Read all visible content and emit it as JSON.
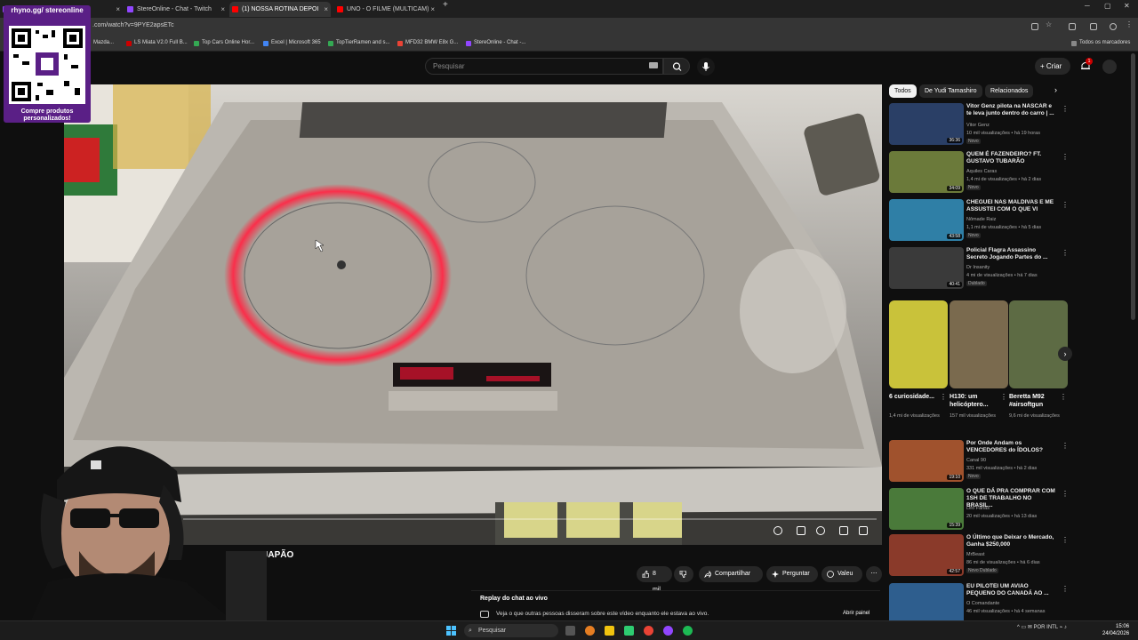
{
  "browser": {
    "tabs": [
      {
        "label": "",
        "color": "#9146ff"
      },
      {
        "label": "StereOnline - Chat - Twitch",
        "color": "#9146ff"
      },
      {
        "label": "(1) NOSSA ROTINA DEPOI",
        "color": "#ff0000"
      },
      {
        "label": "UNO - O FILME (MULTICAM)",
        "color": "#ff0000"
      }
    ],
    "new_tab": "+",
    "url": ".com/watch?v=9PYE2apsETc",
    "bookmarks": [
      {
        "label": "Mazda...",
        "color": "#555555"
      },
      {
        "label": "LS Miata V2.0 Full B...",
        "color": "#cc0000"
      },
      {
        "label": "Top Cars Online Hor...",
        "color": "#34a853"
      },
      {
        "label": "Excel | Microsoft 365",
        "color": "#4285f4"
      },
      {
        "label": "TopTierRamen and s...",
        "color": "#34a853"
      },
      {
        "label": "MFD32 BMW E8x G...",
        "color": "#ea4335"
      },
      {
        "label": "StereOnline - Chat -...",
        "color": "#9146ff"
      }
    ],
    "all_bookmarks": "Todos os marcadores"
  },
  "overlay": {
    "qr_top": "rhyno.gg/ stereonline",
    "qr_bottom": "Compre produtos personalizados!"
  },
  "youtube": {
    "search_placeholder": "Pesquisar",
    "create_label": "Criar",
    "notification_count": "1",
    "video_title": "NO JAPÃO",
    "video_title_prefix": "N",
    "actions": {
      "like": "8 mil",
      "share": "Compartilhar",
      "ask": "Perguntar",
      "thanks": "Valeu"
    },
    "chat_replay": {
      "title": "Replay do chat ao vivo",
      "description": "Veja o que outras pessoas disseram sobre este vídeo enquanto ele estava ao vivo.",
      "open": "Abrir painel"
    },
    "chips": [
      "Todos",
      "De Yudi Tamashiro",
      "Relacionados"
    ],
    "recs": [
      {
        "title": "Vitor Genz pilota na NASCAR e te leva junto dentro do carro | ...",
        "channel": "Vitor Genz",
        "meta": "10 mil visualizações • há 19 horas",
        "badge": "Novo",
        "duration": "36:36",
        "color": "#2a3f66"
      },
      {
        "title": "QUEM É FAZENDEIRO? FT. GUSTAVO TUBARÃO",
        "channel": "Aquiles Caras",
        "meta": "1,4 mi de visualizações • há 2 dias",
        "badge": "Novo",
        "duration": "34:09",
        "color": "#6b7a3a"
      },
      {
        "title": "CHEGUEI NAS MALDIVAS E ME ASSUSTEI COM O QUE VI",
        "channel": "Nômade Raiz",
        "meta": "1,1 mi de visualizações • há 5 dias",
        "badge": "Novo",
        "duration": "43:58",
        "color": "#2f7fa6"
      },
      {
        "title": "Policial Flagra Assassino Secreto Jogando Partes do ...",
        "channel": "Dr Insanity",
        "meta": "4 mi de visualizações • há 7 dias",
        "badge": "Dublado",
        "duration": "40:41",
        "color": "#3a3a3a"
      }
    ],
    "shorts": [
      {
        "title": "6 curiosidade...",
        "views": "1,4 mi de visualizações",
        "color": "#c9c23a"
      },
      {
        "title": "H130: um helicóptero...",
        "views": "157 mil visualizações",
        "color": "#7a6a4e"
      },
      {
        "title": "Beretta M92 #airsoftgun",
        "views": "9,6 mi de visualizações",
        "color": "#5d6b44"
      }
    ],
    "recs2": [
      {
        "title": "Por Onde Andam os VENCEDORES do ÍDOLOS?",
        "channel": "Canal 90",
        "meta": "331 mil visualizações • há 2 dias",
        "badge": "Novo",
        "duration": "19:10",
        "color": "#a0522d"
      },
      {
        "title": "O QUE DÁ PRA COMPRAR COM 1SH DE TRABALHO NO BRASIL...",
        "channel": "Leo Farias",
        "meta": "20 mil visualizações • há 13 dias",
        "badge": "",
        "duration": "15:39",
        "color": "#4a7a3a"
      },
      {
        "title": "O Último que Deixar o Mercado, Ganha $250,000",
        "channel": "MrBeast",
        "meta": "86 mi de visualizações • há 6 dias",
        "badge": "Novo  Dublado",
        "duration": "42:57",
        "color": "#8a3a2a"
      },
      {
        "title": "EU PILOTEI UM AVIÃO PEQUENO DO CANADÁ AO ...",
        "channel": "O Comandante",
        "meta": "46 mil visualizações • há 4 semanas",
        "badge": "",
        "duration": "",
        "color": "#2e5e8e"
      }
    ]
  },
  "taskbar": {
    "search": "Pesquisar",
    "lang": "POR INTL",
    "time": "15:06",
    "date": "24/04/2026"
  }
}
